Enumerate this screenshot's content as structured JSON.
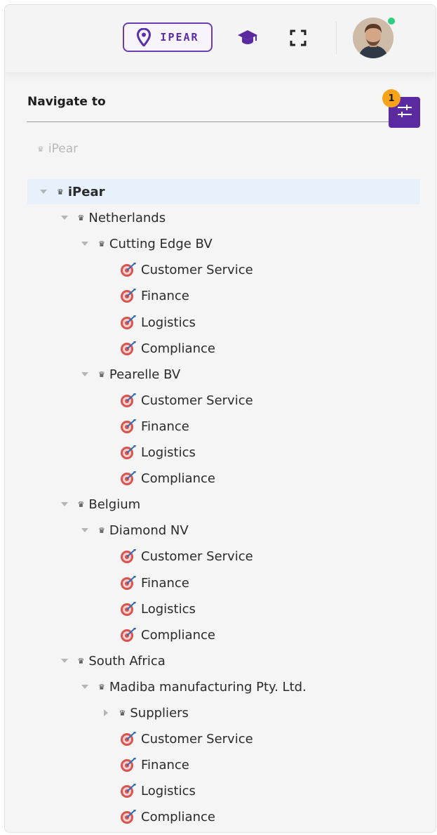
{
  "header": {
    "location_label": "IPEAR",
    "accent_color": "#5b2aa0",
    "online_status_color": "#2ecf7e"
  },
  "navigate": {
    "title": "Navigate to",
    "filter_count": "1",
    "breadcrumb": "iPear"
  },
  "tree": [
    {
      "label": "iPear",
      "level": 0,
      "kind": "org",
      "expanded": true,
      "selected": true
    },
    {
      "label": "Netherlands",
      "level": 1,
      "kind": "org",
      "expanded": true
    },
    {
      "label": "Cutting Edge BV",
      "level": 2,
      "kind": "org",
      "expanded": true
    },
    {
      "label": "Customer Service",
      "level": 3,
      "kind": "dept"
    },
    {
      "label": "Finance",
      "level": 3,
      "kind": "dept"
    },
    {
      "label": "Logistics",
      "level": 3,
      "kind": "dept"
    },
    {
      "label": "Compliance",
      "level": 3,
      "kind": "dept"
    },
    {
      "label": "Pearelle BV",
      "level": 2,
      "kind": "org",
      "expanded": true
    },
    {
      "label": "Customer Service",
      "level": 3,
      "kind": "dept"
    },
    {
      "label": "Finance",
      "level": 3,
      "kind": "dept"
    },
    {
      "label": "Logistics",
      "level": 3,
      "kind": "dept"
    },
    {
      "label": "Compliance",
      "level": 3,
      "kind": "dept"
    },
    {
      "label": "Belgium",
      "level": 1,
      "kind": "org",
      "expanded": true
    },
    {
      "label": "Diamond NV",
      "level": 2,
      "kind": "org",
      "expanded": true
    },
    {
      "label": "Customer Service",
      "level": 3,
      "kind": "dept"
    },
    {
      "label": "Finance",
      "level": 3,
      "kind": "dept"
    },
    {
      "label": "Logistics",
      "level": 3,
      "kind": "dept"
    },
    {
      "label": "Compliance",
      "level": 3,
      "kind": "dept"
    },
    {
      "label": "South Africa",
      "level": 1,
      "kind": "org",
      "expanded": true
    },
    {
      "label": "Madiba manufacturing Pty. Ltd.",
      "level": 2,
      "kind": "org",
      "expanded": true
    },
    {
      "label": "Suppliers",
      "level": 3,
      "kind": "org",
      "expanded": false
    },
    {
      "label": "Customer Service",
      "level": 3,
      "kind": "dept"
    },
    {
      "label": "Finance",
      "level": 3,
      "kind": "dept"
    },
    {
      "label": "Logistics",
      "level": 3,
      "kind": "dept"
    },
    {
      "label": "Compliance",
      "level": 3,
      "kind": "dept"
    }
  ]
}
